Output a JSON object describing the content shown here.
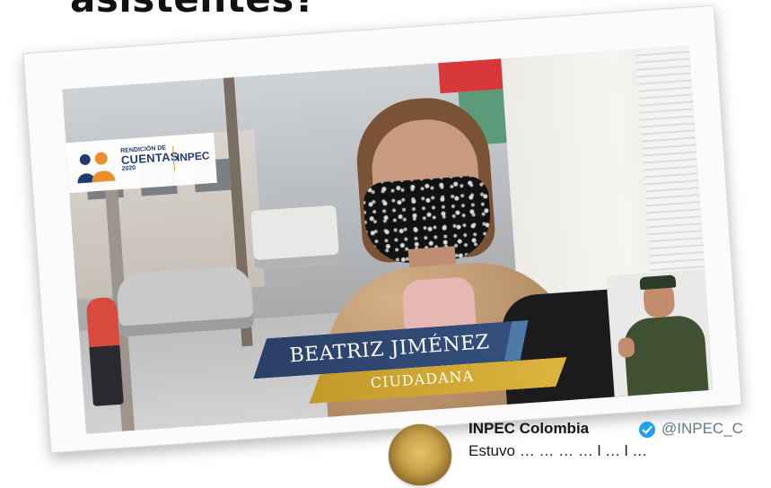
{
  "heading": {
    "fragment": "asistentes?"
  },
  "video": {
    "logo": {
      "line1": "RENDICIÓN DE",
      "line2": "CUENTAS",
      "line3": "2020",
      "brand": "INPEC"
    },
    "lower_third": {
      "name": "BEATRIZ JIMÉNEZ",
      "role": "CIUDADANA"
    },
    "store_sign": "",
    "colors": {
      "name_bar": "#2b3f66",
      "role_bar": "#c39a28",
      "brand_blue": "#1f3b70"
    }
  },
  "tweet": {
    "display_name": "INPEC Colombia",
    "verified": true,
    "handle": "@INPEC_C",
    "text_fragment": "Estuvo … … … … l … l … "
  }
}
